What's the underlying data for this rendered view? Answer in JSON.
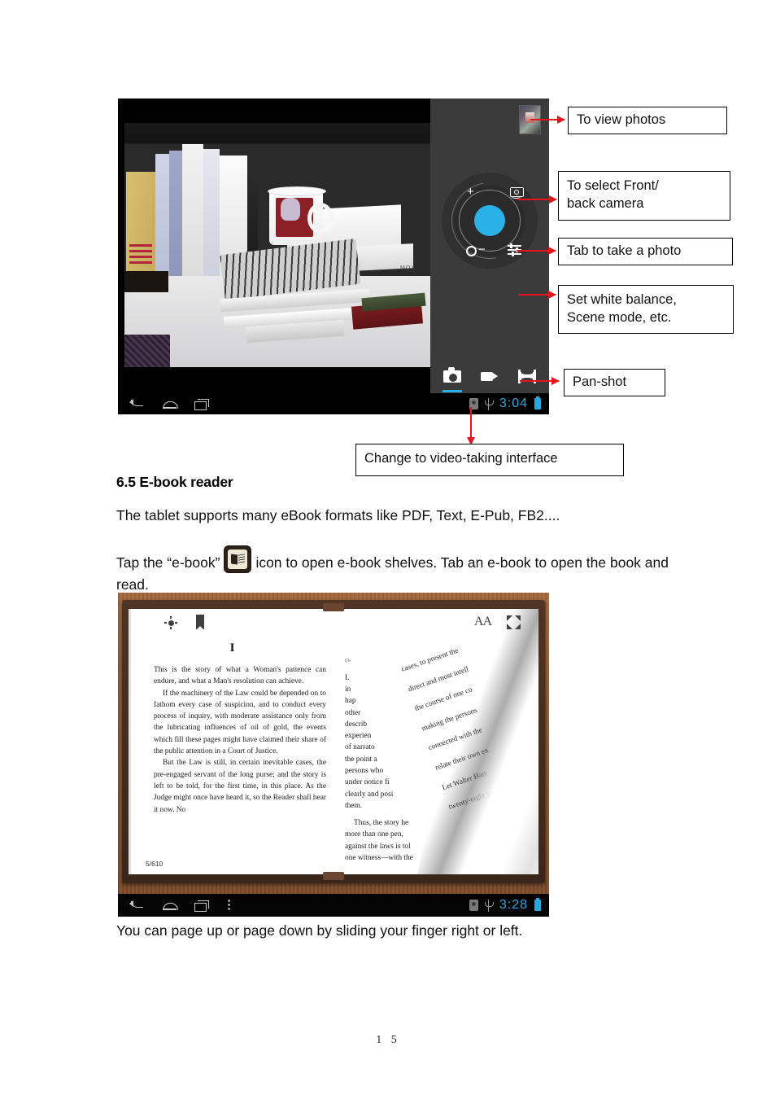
{
  "document": {
    "page_number": "1 5",
    "heading": "6.5 E-book reader",
    "paragraph_1": "The tablet supports many eBook formats like PDF, Text, E-Pub, FB2....",
    "paragraph_2_before_icon": "Tap the “e-book”",
    "paragraph_2_after_icon": "icon to open e-book shelves. Tab an e-book to open the book and read.",
    "paragraph_3": "You can page up or page down by sliding your finger right or left.",
    "ebook_inline_icon": "ebook-icon"
  },
  "camera_screenshot": {
    "callouts": [
      {
        "id": "to-view-photos",
        "label": "To view photos"
      },
      {
        "id": "select-camera",
        "label": "To select Front/\nback camera"
      },
      {
        "id": "take-photo",
        "label": "Tab to take a photo"
      },
      {
        "id": "white-balance",
        "label": "Set white balance,\nScene mode, etc."
      },
      {
        "id": "pan-shot",
        "label": "Pan-shot"
      },
      {
        "id": "video-interface",
        "label": "Change to video-taking interface"
      }
    ],
    "panel": {
      "thumbnail_icon": "photo-thumbnail",
      "switch_camera_icon": "switch-camera-icon",
      "shutter_icon": "shutter-button",
      "settings_icon": "settings-sliders-icon",
      "zoom_in_symbol": "+",
      "zoom_out_symbol": "−",
      "zoom_zero_symbol": "o",
      "modes": [
        {
          "id": "photo",
          "icon": "camera-icon",
          "active": true
        },
        {
          "id": "video",
          "icon": "video-camera-icon",
          "active": false
        },
        {
          "id": "panorama",
          "icon": "panorama-icon",
          "active": false
        }
      ]
    },
    "system_bar": {
      "back_icon": "back-icon",
      "home_icon": "home-icon",
      "recents_icon": "recent-apps-icon",
      "sd_icon": "sd-card-icon",
      "usb_icon": "usb-icon",
      "time": "3:04",
      "battery_icon": "battery-icon"
    },
    "accent_color": "#2ab2e8",
    "arrow_color": "#e8131b"
  },
  "ebook_screenshot": {
    "toolbar": {
      "brightness_icon": "brightness-icon",
      "bookmark_icon": "bookmark-icon",
      "font_size_label": "AA",
      "fullscreen_icon": "fullscreen-icon"
    },
    "left_page": {
      "chapter": "I",
      "paragraphs": [
        "This is the story of what a Woman's patience can endure, and what a Man's resolution can achieve.",
        "If the machinery of the Law could be depended on to fathom every case of suspicion, and to conduct every process of inquiry, with moderate assistance only from the lubricating influences of oil of gold, the events which fill these pages might have claimed their share of the public attention in a Court of Justice.",
        "But the Law is still, in certain inevitable cases, the pre-engaged servant of the long purse; and the story is left to be told, for the first time, in this place. As the Judge might once have heard it, so the Reader shall hear it now. No"
      ],
      "page_counter": "5/610"
    },
    "right_page": {
      "header_fragment": "ci-",
      "column_fragments": [
        "I.",
        "in",
        "hap",
        "other",
        "describ",
        "experien",
        "of narrato",
        "the point a",
        "persons who",
        "under notice fi",
        "clearly and posi",
        "them."
      ],
      "paragraph_fragments": [
        "Thus, the story he",
        "more than one pen, ",
        "against the laws is tol",
        "one witness—with the"
      ],
      "curled_lines": [
        "cases, to present the",
        "direct and most intell",
        "the course of one co",
        "making the persons",
        "connected with the",
        "relate their own ex",
        "Let Walter Hart",
        "twenty-eight yea"
      ]
    },
    "system_bar": {
      "back_icon": "back-icon",
      "home_icon": "home-icon",
      "recents_icon": "recent-apps-icon",
      "menu_icon": "overflow-menu-icon",
      "sd_icon": "sd-card-icon",
      "usb_icon": "usb-icon",
      "time": "3:28",
      "battery_icon": "battery-icon"
    }
  }
}
